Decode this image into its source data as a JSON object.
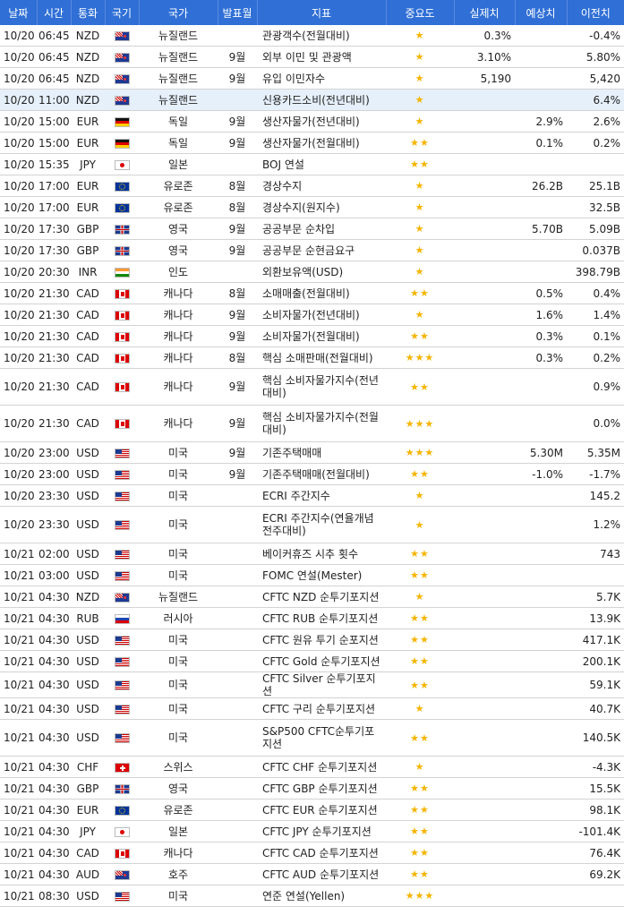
{
  "headers": [
    "날짜",
    "시간",
    "통화",
    "국기",
    "국가",
    "발표월",
    "지표",
    "중요도",
    "실제치",
    "예상치",
    "이전치"
  ],
  "rows": [
    {
      "date": "10/20",
      "time": "06:45",
      "cur": "NZD",
      "flag": "nz-flag-icon",
      "country": "뉴질랜드",
      "month": "",
      "indicator": "관광객수(전월대비)",
      "stars": "★",
      "actual": "0.3%",
      "forecast": "",
      "previous": "-0.4%"
    },
    {
      "date": "10/20",
      "time": "06:45",
      "cur": "NZD",
      "flag": "nz-flag-icon",
      "country": "뉴질랜드",
      "month": "9월",
      "indicator": "외부 이민 및 관광액",
      "stars": "★",
      "actual": "3.10%",
      "forecast": "",
      "previous": "5.80%"
    },
    {
      "date": "10/20",
      "time": "06:45",
      "cur": "NZD",
      "flag": "nz-flag-icon",
      "country": "뉴질랜드",
      "month": "9월",
      "indicator": "유입 이민자수",
      "stars": "★",
      "actual": "5,190",
      "forecast": "",
      "previous": "5,420"
    },
    {
      "date": "10/20",
      "time": "11:00",
      "cur": "NZD",
      "flag": "nz-flag-icon",
      "country": "뉴질랜드",
      "month": "",
      "indicator": "신용카드소비(전년대비)",
      "stars": "★",
      "actual": "",
      "forecast": "",
      "previous": "6.4%"
    },
    {
      "date": "10/20",
      "time": "15:00",
      "cur": "EUR",
      "flag": "de-flag-icon",
      "country": "독일",
      "month": "9월",
      "indicator": "생산자물가(전년대비)",
      "stars": "★",
      "actual": "",
      "forecast": "2.9%",
      "previous": "2.6%"
    },
    {
      "date": "10/20",
      "time": "15:00",
      "cur": "EUR",
      "flag": "de-flag-icon",
      "country": "독일",
      "month": "9월",
      "indicator": "생산자물가(전월대비)",
      "stars": "★★",
      "actual": "",
      "forecast": "0.1%",
      "previous": "0.2%"
    },
    {
      "date": "10/20",
      "time": "15:35",
      "cur": "JPY",
      "flag": "jp-flag-icon",
      "country": "일본",
      "month": "",
      "indicator": "BOJ 연설",
      "stars": "★★",
      "actual": "",
      "forecast": "",
      "previous": ""
    },
    {
      "date": "10/20",
      "time": "17:00",
      "cur": "EUR",
      "flag": "eu-flag-icon",
      "country": "유로존",
      "month": "8월",
      "indicator": "경상수지",
      "stars": "★",
      "actual": "",
      "forecast": "26.2B",
      "previous": "25.1B"
    },
    {
      "date": "10/20",
      "time": "17:00",
      "cur": "EUR",
      "flag": "eu-flag-icon",
      "country": "유로존",
      "month": "8월",
      "indicator": "경상수지(원지수)",
      "stars": "★",
      "actual": "",
      "forecast": "",
      "previous": "32.5B"
    },
    {
      "date": "10/20",
      "time": "17:30",
      "cur": "GBP",
      "flag": "uk-flag-icon",
      "country": "영국",
      "month": "9월",
      "indicator": "공공부문 순차입",
      "stars": "★",
      "actual": "",
      "forecast": "5.70B",
      "previous": "5.09B"
    },
    {
      "date": "10/20",
      "time": "17:30",
      "cur": "GBP",
      "flag": "uk-flag-icon",
      "country": "영국",
      "month": "9월",
      "indicator": "공공부문 순현금요구",
      "stars": "★",
      "actual": "",
      "forecast": "",
      "previous": "0.037B"
    },
    {
      "date": "10/20",
      "time": "20:30",
      "cur": "INR",
      "flag": "in-flag-icon",
      "country": "인도",
      "month": "",
      "indicator": "외환보유액(USD)",
      "stars": "★",
      "actual": "",
      "forecast": "",
      "previous": "398.79B"
    },
    {
      "date": "10/20",
      "time": "21:30",
      "cur": "CAD",
      "flag": "ca-flag-icon",
      "country": "캐나다",
      "month": "8월",
      "indicator": "소매매출(전월대비)",
      "stars": "★★",
      "actual": "",
      "forecast": "0.5%",
      "previous": "0.4%"
    },
    {
      "date": "10/20",
      "time": "21:30",
      "cur": "CAD",
      "flag": "ca-flag-icon",
      "country": "캐나다",
      "month": "9월",
      "indicator": "소비자물가(전년대비)",
      "stars": "★",
      "actual": "",
      "forecast": "1.6%",
      "previous": "1.4%"
    },
    {
      "date": "10/20",
      "time": "21:30",
      "cur": "CAD",
      "flag": "ca-flag-icon",
      "country": "캐나다",
      "month": "9월",
      "indicator": "소비자물가(전월대비)",
      "stars": "★★",
      "actual": "",
      "forecast": "0.3%",
      "previous": "0.1%"
    },
    {
      "date": "10/20",
      "time": "21:30",
      "cur": "CAD",
      "flag": "ca-flag-icon",
      "country": "캐나다",
      "month": "8월",
      "indicator": "핵심 소매판매(전월대비)",
      "stars": "★★★",
      "actual": "",
      "forecast": "0.3%",
      "previous": "0.2%"
    },
    {
      "date": "10/20",
      "time": "21:30",
      "cur": "CAD",
      "flag": "ca-flag-icon",
      "country": "캐나다",
      "month": "9월",
      "indicator": "핵심 소비자물가지수(전년대비)",
      "stars": "★★",
      "actual": "",
      "forecast": "",
      "previous": "0.9%",
      "tall": true
    },
    {
      "date": "10/20",
      "time": "21:30",
      "cur": "CAD",
      "flag": "ca-flag-icon",
      "country": "캐나다",
      "month": "9월",
      "indicator": "핵심 소비자물가지수(전월대비)",
      "stars": "★★★",
      "actual": "",
      "forecast": "",
      "previous": "0.0%",
      "tall": true
    },
    {
      "date": "10/20",
      "time": "23:00",
      "cur": "USD",
      "flag": "us-flag-icon",
      "country": "미국",
      "month": "9월",
      "indicator": "기존주택매매",
      "stars": "★★★",
      "actual": "",
      "forecast": "5.30M",
      "previous": "5.35M"
    },
    {
      "date": "10/20",
      "time": "23:00",
      "cur": "USD",
      "flag": "us-flag-icon",
      "country": "미국",
      "month": "9월",
      "indicator": "기존주택매매(전월대비)",
      "stars": "★★",
      "actual": "",
      "forecast": "-1.0%",
      "previous": "-1.7%"
    },
    {
      "date": "10/20",
      "time": "23:30",
      "cur": "USD",
      "flag": "us-flag-icon",
      "country": "미국",
      "month": "",
      "indicator": "ECRI 주간지수",
      "stars": "★",
      "actual": "",
      "forecast": "",
      "previous": "145.2"
    },
    {
      "date": "10/20",
      "time": "23:30",
      "cur": "USD",
      "flag": "us-flag-icon",
      "country": "미국",
      "month": "",
      "indicator": "ECRI 주간지수(연율개념 전주대비)",
      "stars": "★",
      "actual": "",
      "forecast": "",
      "previous": "1.2%",
      "tall": true
    },
    {
      "date": "10/21",
      "time": "02:00",
      "cur": "USD",
      "flag": "us-flag-icon",
      "country": "미국",
      "month": "",
      "indicator": "베이커휴즈 시추 횟수",
      "stars": "★★",
      "actual": "",
      "forecast": "",
      "previous": "743"
    },
    {
      "date": "10/21",
      "time": "03:00",
      "cur": "USD",
      "flag": "us-flag-icon",
      "country": "미국",
      "month": "",
      "indicator": "FOMC 연설(Mester)",
      "stars": "★★",
      "actual": "",
      "forecast": "",
      "previous": ""
    },
    {
      "date": "10/21",
      "time": "04:30",
      "cur": "NZD",
      "flag": "nz-flag-icon",
      "country": "뉴질랜드",
      "month": "",
      "indicator": "CFTC NZD 순투기포지션",
      "stars": "★",
      "actual": "",
      "forecast": "",
      "previous": "5.7K"
    },
    {
      "date": "10/21",
      "time": "04:30",
      "cur": "RUB",
      "flag": "ru-flag-icon",
      "country": "러시아",
      "month": "",
      "indicator": "CFTC RUB 순투기포지션",
      "stars": "★★",
      "actual": "",
      "forecast": "",
      "previous": "13.9K"
    },
    {
      "date": "10/21",
      "time": "04:30",
      "cur": "USD",
      "flag": "us-flag-icon",
      "country": "미국",
      "month": "",
      "indicator": "CFTC 원유 투기 순포지션",
      "stars": "★★",
      "actual": "",
      "forecast": "",
      "previous": "417.1K"
    },
    {
      "date": "10/21",
      "time": "04:30",
      "cur": "USD",
      "flag": "us-flag-icon",
      "country": "미국",
      "month": "",
      "indicator": "CFTC Gold 순투기포지션",
      "stars": "★★",
      "actual": "",
      "forecast": "",
      "previous": "200.1K"
    },
    {
      "date": "10/21",
      "time": "04:30",
      "cur": "USD",
      "flag": "us-flag-icon",
      "country": "미국",
      "month": "",
      "indicator": "CFTC Silver 순투기포지션",
      "stars": "★★",
      "actual": "",
      "forecast": "",
      "previous": "59.1K"
    },
    {
      "date": "10/21",
      "time": "04:30",
      "cur": "USD",
      "flag": "us-flag-icon",
      "country": "미국",
      "month": "",
      "indicator": "CFTC 구리 순투기포지션",
      "stars": "★",
      "actual": "",
      "forecast": "",
      "previous": "40.7K"
    },
    {
      "date": "10/21",
      "time": "04:30",
      "cur": "USD",
      "flag": "us-flag-icon",
      "country": "미국",
      "month": "",
      "indicator": "S&P500 CFTC순투기포지션",
      "stars": "★★",
      "actual": "",
      "forecast": "",
      "previous": "140.5K",
      "tall": true
    },
    {
      "date": "10/21",
      "time": "04:30",
      "cur": "CHF",
      "flag": "ch-flag-icon",
      "country": "스위스",
      "month": "",
      "indicator": "CFTC CHF 순투기포지션",
      "stars": "★",
      "actual": "",
      "forecast": "",
      "previous": "-4.3K"
    },
    {
      "date": "10/21",
      "time": "04:30",
      "cur": "GBP",
      "flag": "uk-flag-icon",
      "country": "영국",
      "month": "",
      "indicator": "CFTC GBP 순투기포지션",
      "stars": "★★",
      "actual": "",
      "forecast": "",
      "previous": "15.5K"
    },
    {
      "date": "10/21",
      "time": "04:30",
      "cur": "EUR",
      "flag": "eu-flag-icon",
      "country": "유로존",
      "month": "",
      "indicator": "CFTC EUR 순투기포지션",
      "stars": "★★",
      "actual": "",
      "forecast": "",
      "previous": "98.1K"
    },
    {
      "date": "10/21",
      "time": "04:30",
      "cur": "JPY",
      "flag": "jp-flag-icon",
      "country": "일본",
      "month": "",
      "indicator": "CFTC JPY 순투기포지션",
      "stars": "★★",
      "actual": "",
      "forecast": "",
      "previous": "-101.4K"
    },
    {
      "date": "10/21",
      "time": "04:30",
      "cur": "CAD",
      "flag": "ca-flag-icon",
      "country": "캐나다",
      "month": "",
      "indicator": "CFTC CAD 순투기포지션",
      "stars": "★★",
      "actual": "",
      "forecast": "",
      "previous": "76.4K"
    },
    {
      "date": "10/21",
      "time": "04:30",
      "cur": "AUD",
      "flag": "au-flag-icon",
      "country": "호주",
      "month": "",
      "indicator": "CFTC AUD 순투기포지션",
      "stars": "★★",
      "actual": "",
      "forecast": "",
      "previous": "69.2K"
    },
    {
      "date": "10/21",
      "time": "08:30",
      "cur": "USD",
      "flag": "us-flag-icon",
      "country": "미국",
      "month": "",
      "indicator": "연준 연설(Yellen)",
      "stars": "★★★",
      "actual": "",
      "forecast": "",
      "previous": ""
    }
  ],
  "highlighted_row": 3
}
